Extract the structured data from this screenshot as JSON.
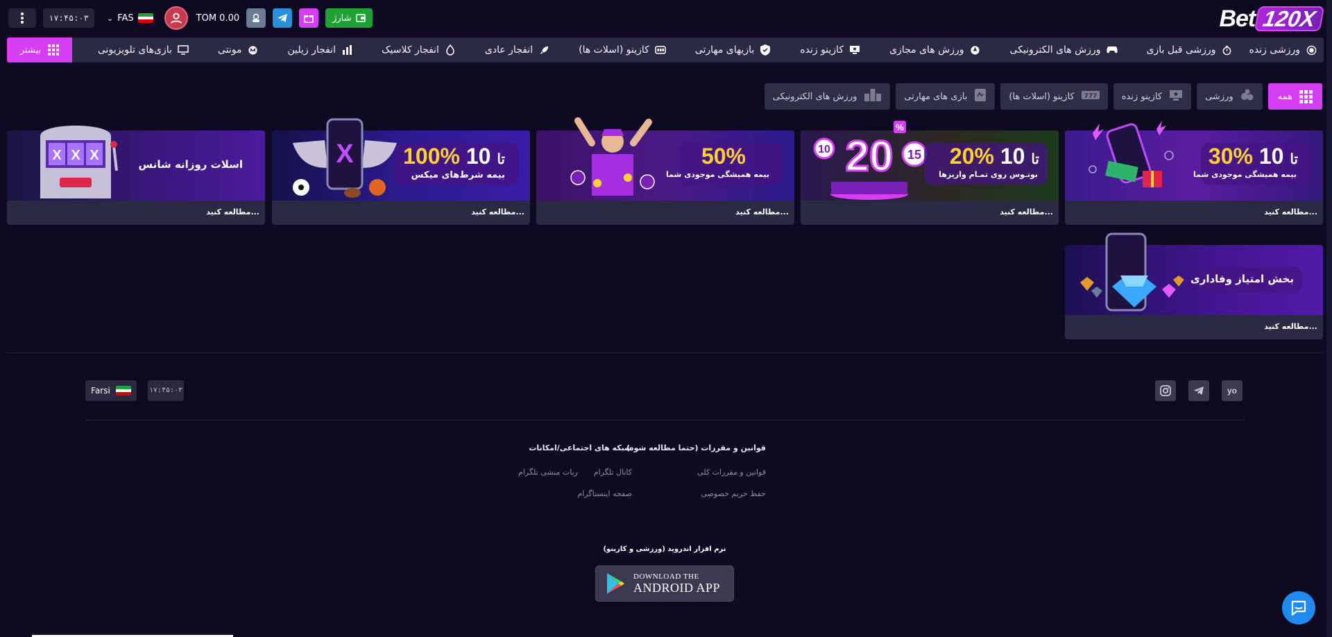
{
  "header": {
    "logo_text": "Bet",
    "logo_number": "120X",
    "clock": "۱۷:۴۵:۰۳",
    "language": "FAS",
    "balance": "TOM 0.00",
    "charge_label": "شارژ"
  },
  "nav": {
    "items": [
      {
        "label": "ورزشی زنده",
        "icon": "live-sport-icon"
      },
      {
        "label": "ورزشی قبل بازی",
        "icon": "stopwatch-icon"
      },
      {
        "label": "ورزش های الکترونیکی",
        "icon": "gamepad-icon"
      },
      {
        "label": "ورزش های مجازی",
        "icon": "virtual-sport-icon"
      },
      {
        "label": "کازینو زنده",
        "icon": "live-casino-icon"
      },
      {
        "label": "بازیهای مهارتی",
        "icon": "shield-check-icon"
      },
      {
        "label": "کازینو (اسلات ها)",
        "icon": "slots-icon"
      },
      {
        "label": "انفجار عادی",
        "icon": "rocket-icon"
      },
      {
        "label": "انفجار کلاسیک",
        "icon": "classic-crash-icon"
      },
      {
        "label": "انفجار زیلین",
        "icon": "bar-chart-icon"
      },
      {
        "label": "مونتی",
        "icon": "monty-icon"
      },
      {
        "label": "بازی‌های تلویزیونی",
        "icon": "tv-icon"
      }
    ],
    "more_label": "بیشتر"
  },
  "filters": {
    "tabs": [
      {
        "label": "همه",
        "active": true
      },
      {
        "label": "ورزشی",
        "active": false
      },
      {
        "label": "کازینو زنده",
        "active": false
      },
      {
        "label": "کازینو (اسلات ها)",
        "active": false
      },
      {
        "label": "بازی های مهارتی",
        "active": false
      },
      {
        "label": "ورزش های الکترونیکی",
        "active": false
      }
    ]
  },
  "promos": [
    {
      "big_a": "10",
      "mid": "تا",
      "big_b": "30%",
      "sub": "بیمه همیشگی موجودی شما",
      "read_more": "مطالعه کنید..."
    },
    {
      "big_a": "10",
      "mid": "تا",
      "big_b": "20%",
      "sub": "بونـوس روی تمـام واریزها",
      "read_more": "مطالعه کنید..."
    },
    {
      "big_b": "50%",
      "sub": "بیمه همیشگی موجودی شما",
      "read_more": "مطالعه کنید..."
    },
    {
      "big_a": "10",
      "mid": "تا",
      "big_b": "100%",
      "sub": "بیمه شرط‌های میکس",
      "read_more": "مطالعه کنید..."
    },
    {
      "title": "اسلات روزانه شانس",
      "read_more": "مطالعه کنید..."
    },
    {
      "title": "بخش امتیاز وفاداری",
      "read_more": "مطالعه کنید..."
    }
  ],
  "footer": {
    "clock": "۱۷:۴۵:۰۳",
    "language": "Farsi",
    "rules_title": "قوانین و مقررات (حتما مطالعه شود)",
    "rules_links": [
      "قوانین و مقررات کلی",
      "حفظ حریم خصوصی"
    ],
    "social_title": "شبکه های اجتماعی/امکانات",
    "social_links": [
      "کانال تلگرام",
      "ربات منشی تلگرام",
      "صفحه اینستاگرام"
    ],
    "app_caption": "نرم افزار اندروید (ورزشی و کازینو)",
    "app_line1": "DOWNLOAD THE",
    "app_line2": "ANDROID APP"
  },
  "colors": {
    "accent": "#d63ef3",
    "background": "#0d0a22",
    "nav_bg": "#2b2a44",
    "charge_green": "#1fa133",
    "highlight_yellow": "#ffd232"
  }
}
